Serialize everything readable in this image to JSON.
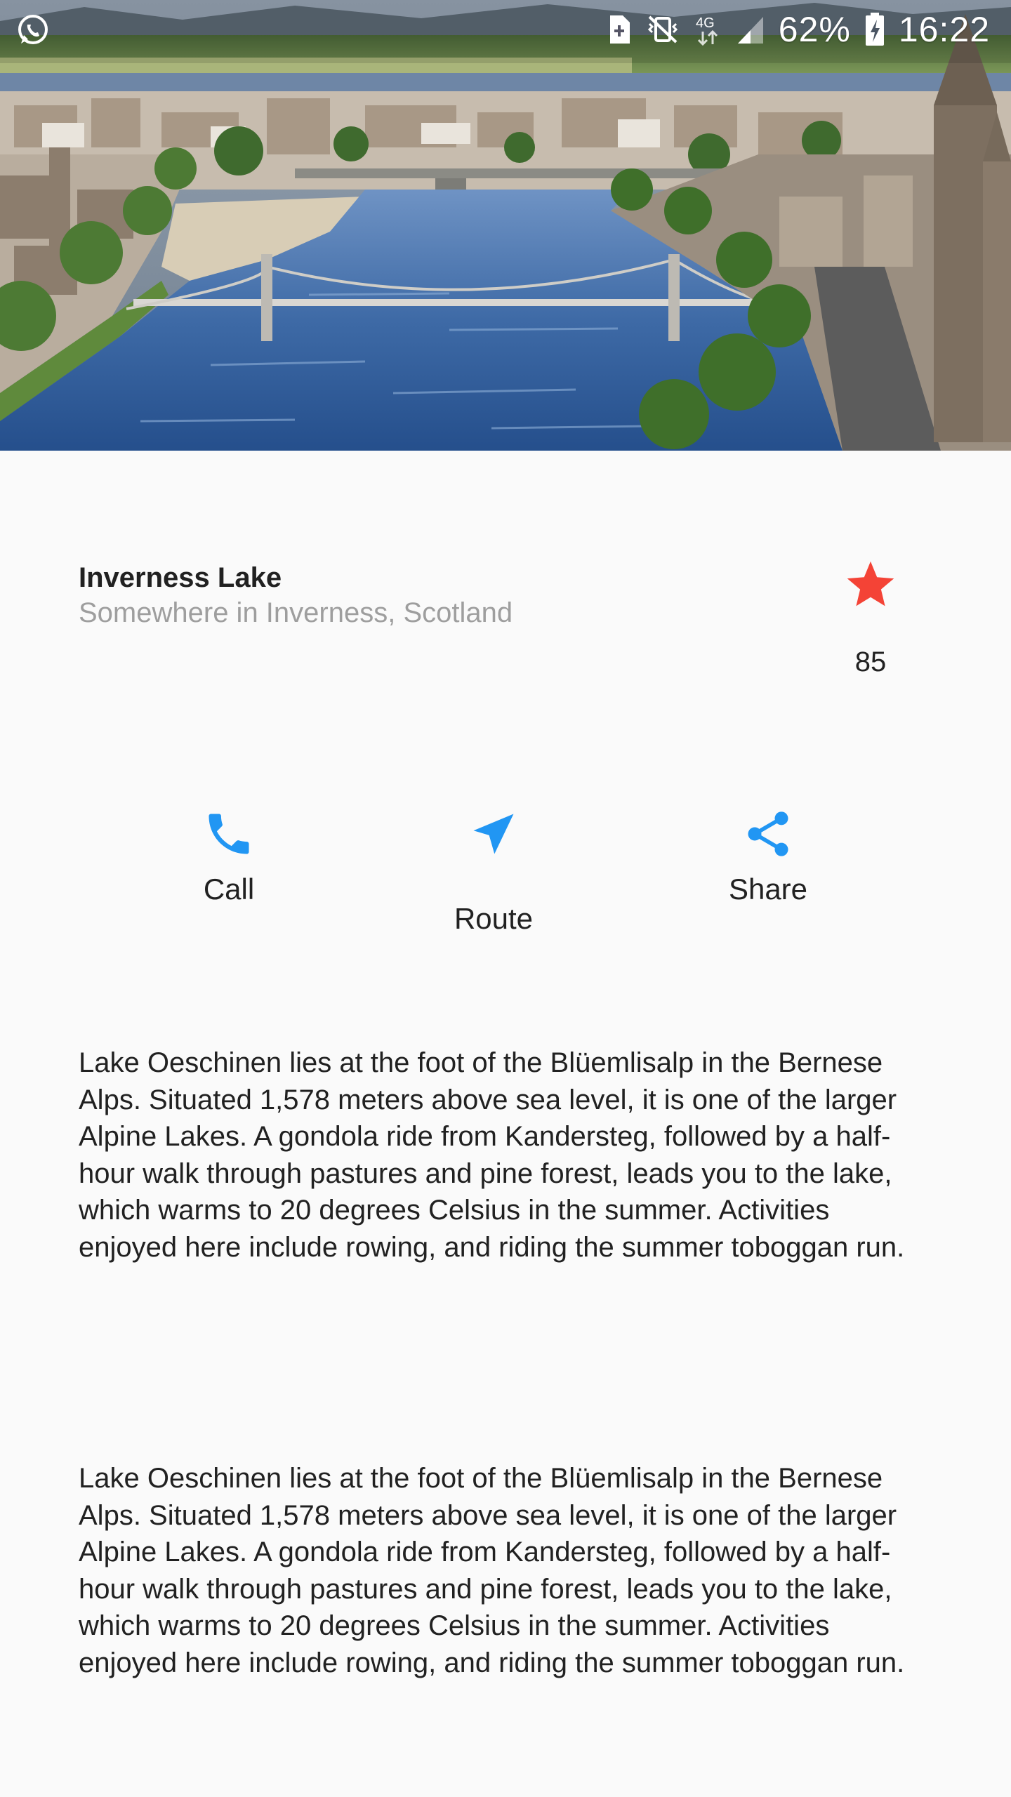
{
  "status_bar": {
    "left_icons": [
      "whatsapp-icon"
    ],
    "right_icons": [
      "sim-card-icon",
      "vibrate-mute-icon",
      "network-4g-icon",
      "signal-icon",
      "battery-charging-icon"
    ],
    "network_label": "4G",
    "battery_percent": "62%",
    "time": "16:22"
  },
  "hero": {
    "image_desc_icon": "city-river-photo"
  },
  "place": {
    "title": "Inverness Lake",
    "subtitle": "Somewhere in Inverness, Scotland",
    "favorite_count": "85",
    "favorite_icon": "star-icon"
  },
  "actions": [
    {
      "label": "Call",
      "icon": "phone-icon"
    },
    {
      "label": "Route",
      "icon": "navigation-icon"
    },
    {
      "label": "Share",
      "icon": "share-icon"
    }
  ],
  "descriptions": [
    "Lake Oeschinen lies at the foot of the Blüemlisalp in the Bernese Alps. Situated 1,578 meters above sea level, it is one of the larger Alpine Lakes. A gondola ride from Kandersteg, followed by a half-hour walk through pastures and pine forest, leads you to the lake, which warms to 20 degrees Celsius in the summer. Activities enjoyed here include rowing, and riding the summer toboggan run.",
    "Lake Oeschinen lies at the foot of the Blüemlisalp in the Bernese Alps. Situated 1,578 meters above sea level, it is one of the larger Alpine Lakes. A gondola ride from Kandersteg, followed by a half-hour walk through pastures and pine forest, leads you to the lake, which warms to 20 degrees Celsius in the summer. Activities enjoyed here include rowing, and riding the summer toboggan run."
  ],
  "colors": {
    "accent": "#2196f3",
    "star": "#f44336",
    "background": "#fafafa",
    "subtitle": "#9e9e9e",
    "text": "#212121"
  }
}
